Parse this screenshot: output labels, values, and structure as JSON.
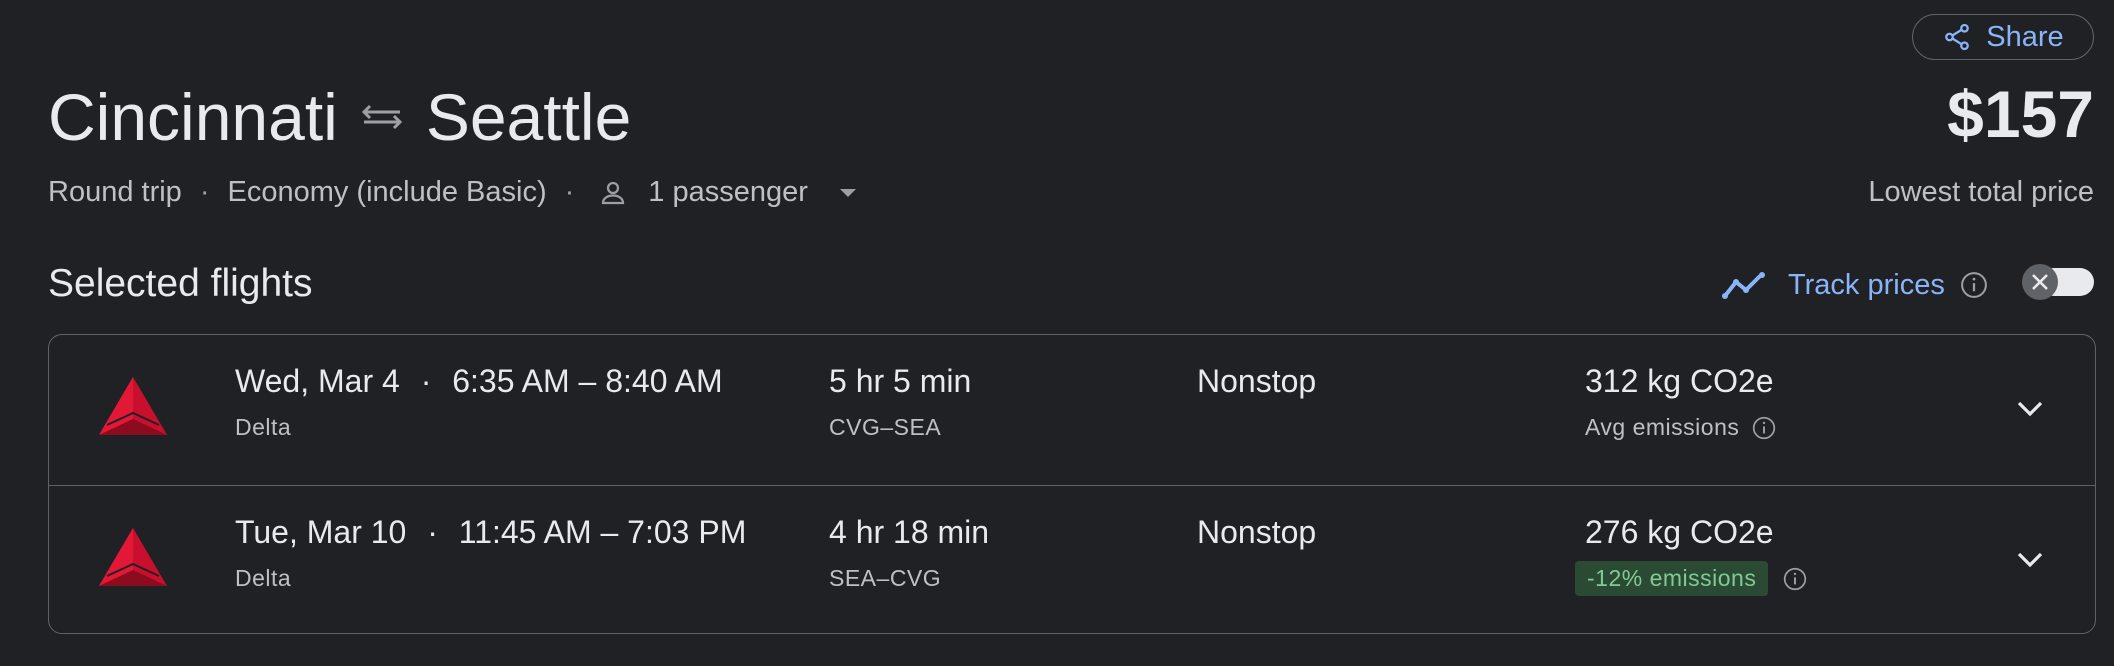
{
  "header": {
    "share_label": "Share",
    "origin": "Cincinnati",
    "destination": "Seattle",
    "price": "$157",
    "price_caption": "Lowest total price"
  },
  "options": {
    "trip_type": "Round trip",
    "cabin": "Economy (include Basic)",
    "passengers": "1 passenger"
  },
  "section": {
    "title": "Selected flights",
    "track_label": "Track prices",
    "track_enabled": false
  },
  "colors": {
    "accent": "#8ab4f8",
    "delta_red": "#c8102e",
    "badge_green": "#81c995"
  },
  "flights": [
    {
      "date": "Wed, Mar 4",
      "times": "6:35 AM – 8:40 AM",
      "airline": "Delta",
      "duration": "5 hr 5 min",
      "route": "CVG–SEA",
      "stops": "Nonstop",
      "emissions": "312 kg CO2e",
      "emissions_note": "Avg emissions"
    },
    {
      "date": "Tue, Mar 10",
      "times": "11:45 AM – 7:03 PM",
      "airline": "Delta",
      "duration": "4 hr 18 min",
      "route": "SEA–CVG",
      "stops": "Nonstop",
      "emissions": "276 kg CO2e",
      "emissions_note": "-12% emissions"
    }
  ]
}
